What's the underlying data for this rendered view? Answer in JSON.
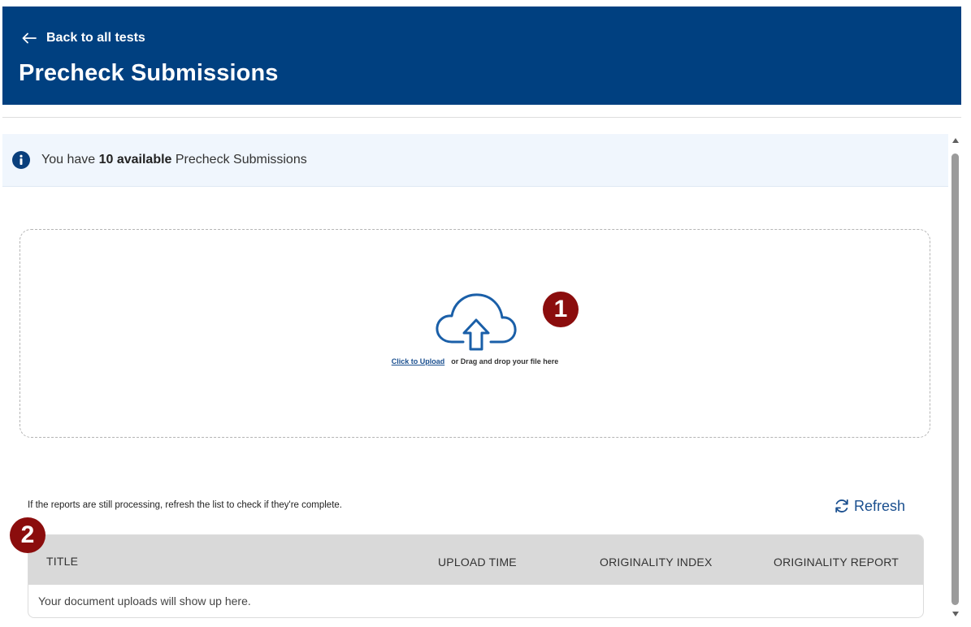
{
  "header": {
    "back_label": "Back to all tests",
    "title": "Precheck Submissions",
    "background": "#004080"
  },
  "info": {
    "prefix": "You have ",
    "count_text": "10 available",
    "suffix": " Precheck Submissions"
  },
  "upload": {
    "link_label": "Click to Upload",
    "hint": "or Drag and drop your file here"
  },
  "badges": {
    "one": "1",
    "two": "2",
    "color": "#8b0d0d"
  },
  "list": {
    "note": "If the reports are still processing, refresh the list to check if they're complete.",
    "refresh_label": "Refresh"
  },
  "table": {
    "columns": [
      "TITLE",
      "UPLOAD TIME",
      "ORIGINALITY INDEX",
      "ORIGINALITY REPORT"
    ],
    "empty_message": "Your document uploads will show up here."
  },
  "icons": {
    "back": "arrow-left-icon",
    "info": "info-icon",
    "upload": "cloud-upload-icon",
    "refresh": "refresh-icon"
  },
  "accent": "#1a4f8f"
}
